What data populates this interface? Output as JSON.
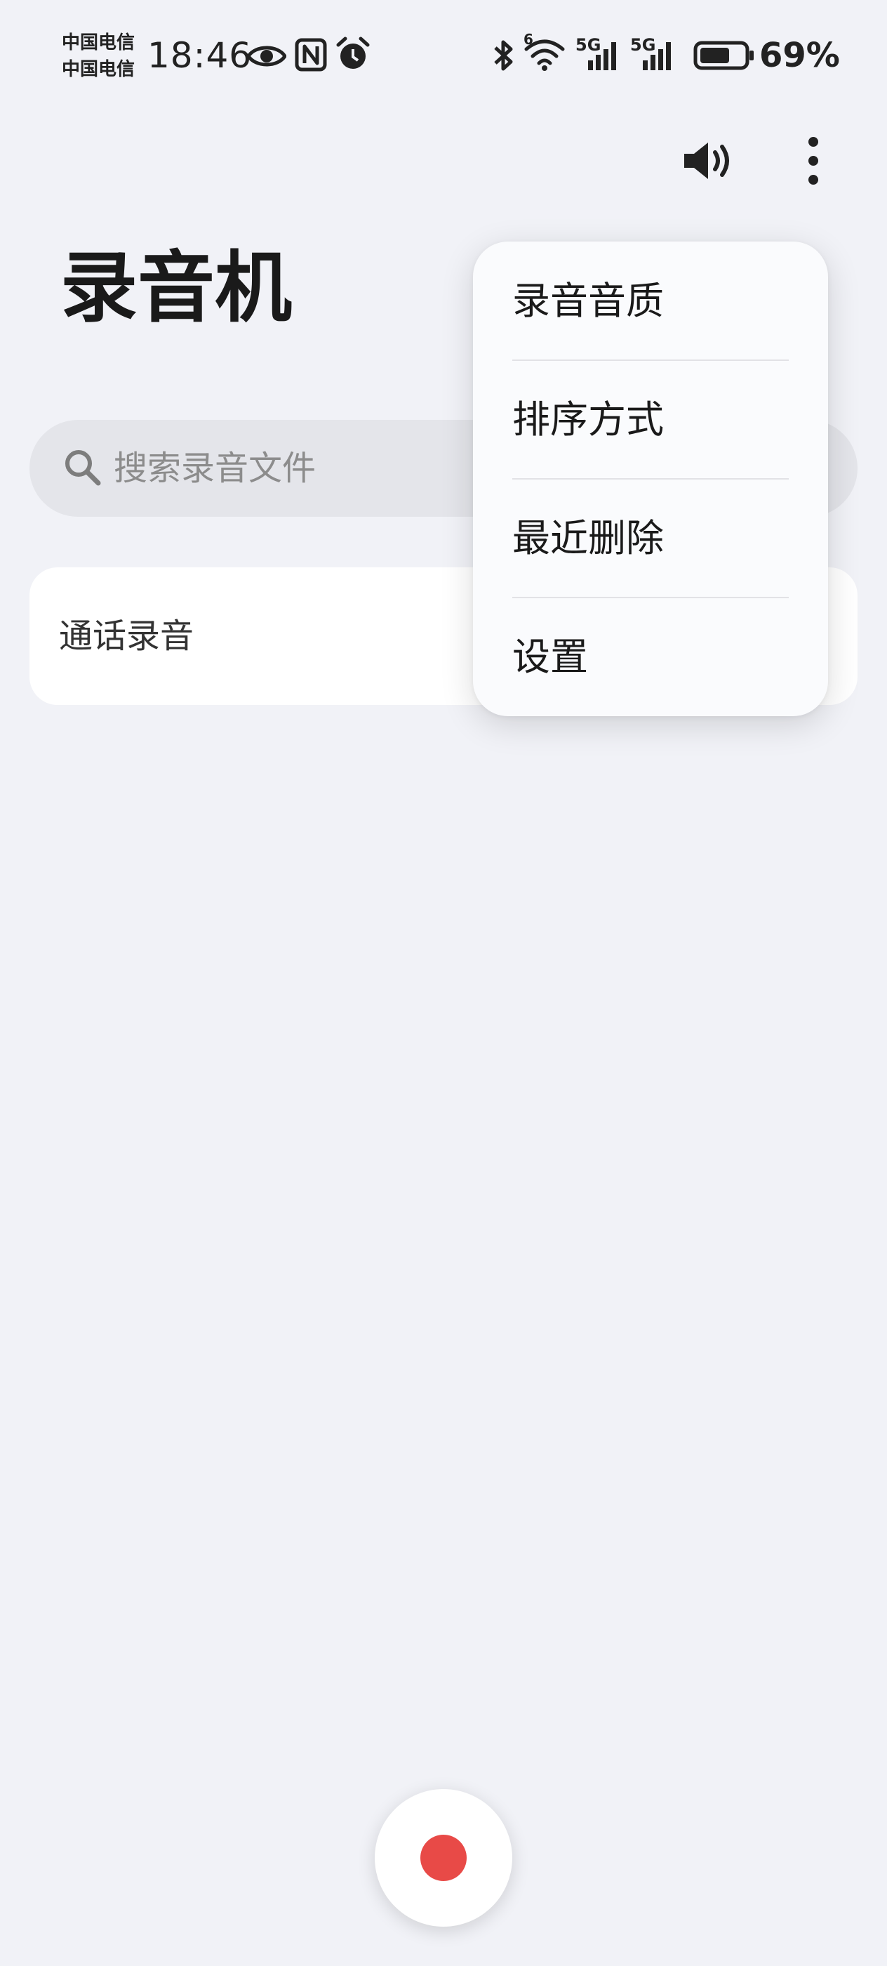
{
  "status_bar": {
    "carrier_1": "中国电信",
    "carrier_2": "中国电信",
    "time": "18:46",
    "battery_percent": "69%",
    "battery_level": 0.69,
    "wifi_badge": "6",
    "network_1": "5G",
    "network_2": "5G",
    "icons": [
      "eye-icon",
      "nfc-icon",
      "alarm-icon",
      "bluetooth-icon",
      "wifi-icon",
      "signal-icon",
      "signal-icon",
      "battery-icon"
    ]
  },
  "toolbar": {
    "icons": [
      "speaker-icon",
      "more-vertical-icon"
    ]
  },
  "page": {
    "title": "录音机"
  },
  "search": {
    "placeholder": "搜索录音文件",
    "icon": "search-icon"
  },
  "list": {
    "items": [
      {
        "label": "通话录音"
      }
    ]
  },
  "menu": {
    "items": [
      {
        "label": "录音音质"
      },
      {
        "label": "排序方式"
      },
      {
        "label": "最近删除"
      },
      {
        "label": "设置"
      }
    ]
  },
  "record_button": {
    "icon": "record-icon",
    "accent_color": "#e84a47"
  },
  "colors": {
    "background": "#f1f2f7",
    "card": "#ffffff",
    "search_bg": "#e4e5ea",
    "record_red": "#e84a47"
  }
}
